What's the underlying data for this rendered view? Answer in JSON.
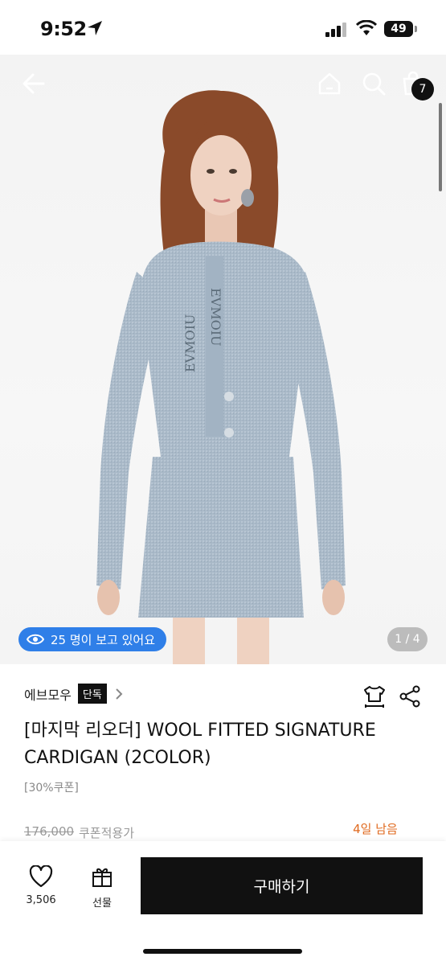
{
  "status": {
    "time": "9:52",
    "battery": "49"
  },
  "nav": {
    "cart_count": "7"
  },
  "gallery": {
    "viewers": "25 명이 보고 있어요",
    "page_indicator": "1 / 4"
  },
  "product": {
    "brand": "에브모우",
    "exclusive_badge": "단독",
    "title": "[마지막 리오더] WOOL FITTED SIGNATURE CARDIGAN (2COLOR)",
    "coupon": "[30%쿠폰]",
    "original_price": "176,000",
    "coupon_price_label": "쿠폰적용가",
    "days_left": "4일 남음"
  },
  "bottom": {
    "like_count": "3,506",
    "gift_label": "선물",
    "buy_label": "구매하기"
  },
  "colors": {
    "accent_blue": "#2f7fe8",
    "days_left_orange": "#e06a1f",
    "buy_button": "#111111"
  }
}
